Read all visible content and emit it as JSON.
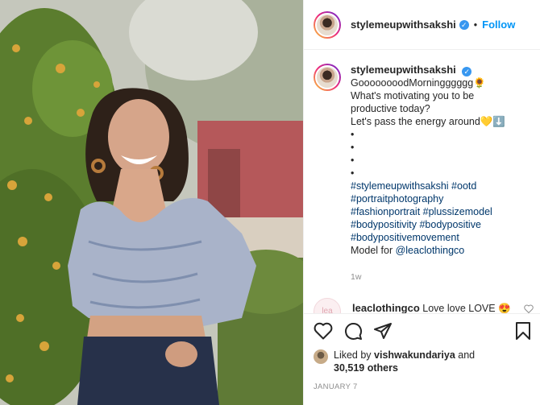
{
  "header": {
    "username": "stylemeupwithsakshi",
    "verified_mark": "✓",
    "separator": "•",
    "follow_label": "Follow"
  },
  "caption": {
    "username": "stylemeupwithsakshi",
    "verified_mark": "✓",
    "lines": [
      "GoooooooodMorningggggg🌻",
      "What's motivating you to be",
      "productive today?",
      "Let's pass the energy around💛⬇️",
      "•",
      "•",
      "•",
      "•"
    ],
    "hashtag_lines": [
      "#stylemeupwithsakshi #ootd",
      "#portraitphotography",
      "#fashionportrait #plussizemodel",
      "#bodypositivity #bodypositive",
      "#bodypositivemovement"
    ],
    "credit_prefix": "Model for ",
    "credit_mention": "@leaclothingco",
    "age": "1w"
  },
  "comment": {
    "avatar_text": "lea",
    "username": "leaclothingco",
    "text": " Love love LOVE 😍"
  },
  "actions": {
    "icons": [
      "heart-icon",
      "comment-icon",
      "share-icon",
      "bookmark-icon"
    ]
  },
  "likes": {
    "prefix": "Liked by ",
    "user": "vishwakundariya",
    "middle": " and",
    "count": "30,519 others"
  },
  "date": "JANUARY 7"
}
